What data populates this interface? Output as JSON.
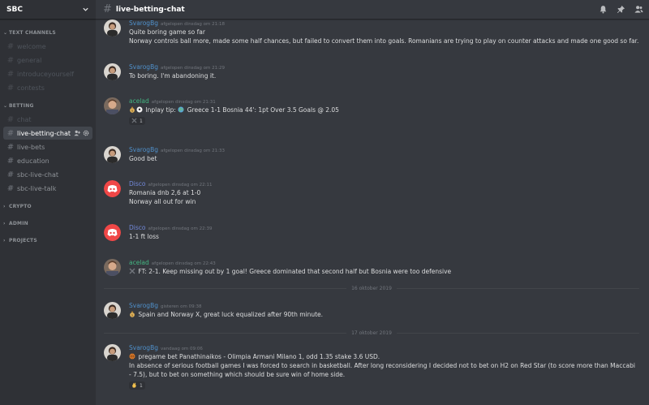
{
  "server": {
    "name": "SBC"
  },
  "sidebar": {
    "categories": [
      {
        "name": "TEXT CHANNELS",
        "channels": [
          "welcome",
          "general",
          "introduceyourself",
          "contests"
        ]
      },
      {
        "name": "BETTING",
        "channels": [
          "chat",
          "live-betting-chat",
          "live-bets",
          "education",
          "sbc-live-chat",
          "sbc-live-talk"
        ]
      },
      {
        "name": "CRYPTO"
      },
      {
        "name": "ADMIN"
      },
      {
        "name": "PROJECTS"
      }
    ]
  },
  "channel": {
    "name": "live-betting-chat"
  },
  "messages": [
    {
      "author": "SvarogBg",
      "timestamp": "afgelopen dinsdag om 21:18",
      "lines": [
        "Quite boring game so far",
        "Norway controls ball more, made some half chances, but failed to convert them into goals. Romanians are trying to play on counter attacks and made one good so far."
      ]
    },
    {
      "author": "SvarogBg",
      "timestamp": "afgelopen dinsdag om 21:29",
      "lines": [
        "To boring. I'm abandoning it."
      ]
    },
    {
      "author": "acelad",
      "timestamp": "afgelopen dinsdag om 21:31",
      "text": "Inplay tip:",
      "text2": "Greece 1-1 Bosnia 44': 1pt Over 3.5 Goals @ 2.05",
      "reaction_count": "1"
    },
    {
      "author": "SvarogBg",
      "timestamp": "afgelopen dinsdag om 21:33",
      "lines": [
        "Good bet"
      ]
    },
    {
      "author": "Disco",
      "timestamp": "afgelopen dinsdag om 22:11",
      "lines": [
        "Romania dnb 2,6 at 1-0",
        "Norway all out for win"
      ]
    },
    {
      "author": "Disco",
      "timestamp": "afgelopen dinsdag om 22:39",
      "lines": [
        "1-1 ft loss"
      ]
    },
    {
      "author": "acelad",
      "timestamp": "afgelopen dinsdag om 22:43",
      "text": "FT: 2-1. Keep missing out by 1 goal! Greece dominated that second half but Bosnia were too defensive"
    },
    {
      "author": "SvarogBg",
      "timestamp": "gisteren om 09:38",
      "text": "Spain and Norway X, great luck equalized after 90th minute."
    },
    {
      "author": "SvarogBg",
      "timestamp": "vandaag om 09:06",
      "text": "pregame bet Panathinaikos - Olimpia Armani Milano 1, odd 1.35 stake 3.6 USD.",
      "text2": "In absence of serious football games I was forced to search in basketball. After long reconsidering I decided not to bet on H2 on Red Star (to score more than Maccabi - 7.5), but to bet on something which should be sure win of home side.",
      "reaction_count": "1"
    }
  ],
  "dividers": [
    "16 oktober 2019",
    "17 oktober 2019"
  ],
  "colors": {
    "background": "#36393f",
    "sidebar": "#2f3136",
    "svarog": "#4f8fc9",
    "acelad": "#43b581",
    "disco": "#7289da"
  }
}
